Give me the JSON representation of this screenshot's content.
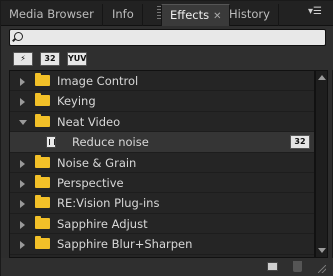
{
  "tabs": [
    {
      "label": "Media Browser"
    },
    {
      "label": "Info"
    },
    {
      "label": "Effects",
      "active": true
    },
    {
      "label": "History"
    }
  ],
  "search": {
    "value": "",
    "placeholder": ""
  },
  "filters": [
    {
      "label": "",
      "icon": "accelerated-effects-icon"
    },
    {
      "label": "32"
    },
    {
      "label": "YUV"
    }
  ],
  "tree": [
    {
      "label": "Image Control",
      "type": "folder",
      "expanded": false
    },
    {
      "label": "Keying",
      "type": "folder",
      "expanded": false
    },
    {
      "label": "Neat Video",
      "type": "folder",
      "expanded": true
    },
    {
      "label": "Reduce noise",
      "type": "effect",
      "badge": "32"
    },
    {
      "label": "Noise & Grain",
      "type": "folder",
      "expanded": false
    },
    {
      "label": "Perspective",
      "type": "folder",
      "expanded": false
    },
    {
      "label": "RE:Vision Plug-ins",
      "type": "folder",
      "expanded": false
    },
    {
      "label": "Sapphire Adjust",
      "type": "folder",
      "expanded": false
    },
    {
      "label": "Sapphire Blur+Sharpen",
      "type": "folder",
      "expanded": false
    }
  ],
  "colors": {
    "accent": "#f2c028",
    "panel_bg": "#2d2d2d"
  }
}
